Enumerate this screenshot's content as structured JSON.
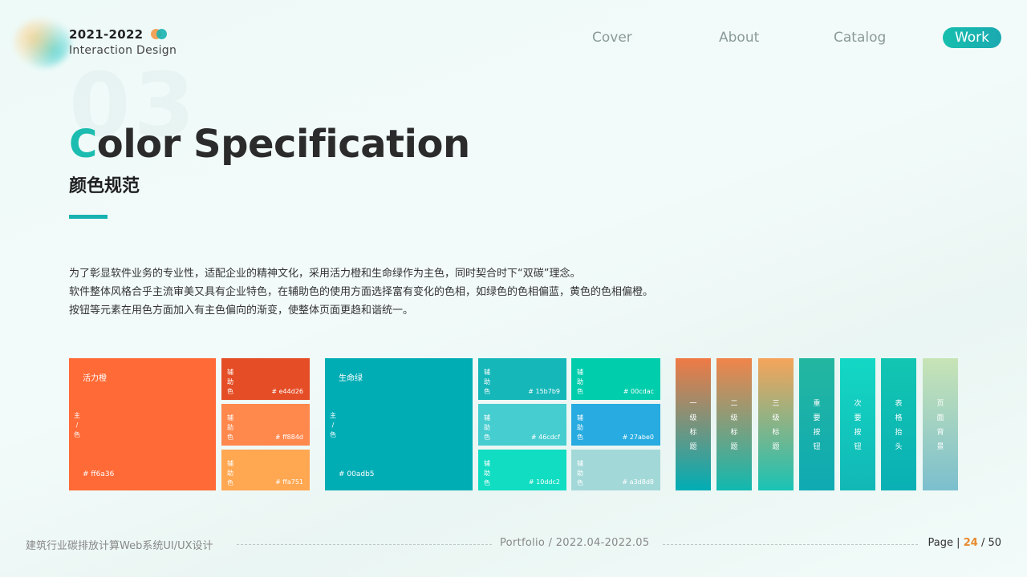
{
  "brand": {
    "year": "2021-2022",
    "subtitle": "Interaction Design"
  },
  "nav": {
    "items": [
      "Cover",
      "About",
      "Catalog",
      "Work"
    ],
    "active": "Work"
  },
  "section": {
    "number": "03",
    "title_first": "C",
    "title_rest": "olor Specification",
    "subtitle": "颜色规范"
  },
  "description": [
    "为了彰显软件业务的专业性，适配企业的精神文化，采用活力橙和生命绿作为主色，同时契合时下“双碳”理念。",
    "软件整体风格合乎主流审美又具有企业特色，在辅助色的使用方面选择富有变化的色相，如绿色的色相偏蓝，黄色的色相偏橙。",
    "按钮等元素在用色方面加入有主色偏向的渐变，使整体页面更趋和谐统一。"
  ],
  "palette": {
    "orange_main": {
      "name": "活力橙",
      "tag": "主/色",
      "hex": "# ff6a36",
      "color": "#ff6a36"
    },
    "orange_aux": [
      {
        "tag": "辅助色",
        "hex": "# e44d26",
        "color": "#e44d26"
      },
      {
        "tag": "辅助色",
        "hex": "# ff884d",
        "color": "#ff884d"
      },
      {
        "tag": "辅助色",
        "hex": "# ffa751",
        "color": "#ffa751"
      }
    ],
    "green_main": {
      "name": "生命绿",
      "tag": "主/色",
      "hex": "# 00adb5",
      "color": "#00adb5"
    },
    "green_aux": [
      {
        "tag": "辅助色",
        "hex": "# 15b7b9",
        "color": "#15b7b9"
      },
      {
        "tag": "辅助色",
        "hex": "# 00cdac",
        "color": "#00cdac"
      },
      {
        "tag": "辅助色",
        "hex": "# 46cdcf",
        "color": "#46cdcf"
      },
      {
        "tag": "辅助色",
        "hex": "# 27abe0",
        "color": "#27abe0"
      },
      {
        "tag": "辅助色",
        "hex": "# 10ddc2",
        "color": "#10ddc2"
      },
      {
        "tag": "辅助色",
        "hex": "# a3d8d8",
        "color": "#a3d8d8"
      }
    ]
  },
  "gradients": [
    {
      "label": "一级标题",
      "from": "#f07a45",
      "to": "#00adb5"
    },
    {
      "label": "二级标题",
      "from": "#f1844a",
      "to": "#10b9b0"
    },
    {
      "label": "三级标题",
      "from": "#f6a45a",
      "to": "#19c3b5"
    },
    {
      "label": "重要按钮",
      "from": "#23b6a0",
      "to": "#0faab3"
    },
    {
      "label": "次要按钮",
      "from": "#13d8c4",
      "to": "#12b7b6"
    },
    {
      "label": "表格抬头",
      "from": "#12c6b2",
      "to": "#0ab0b4"
    },
    {
      "label": "页面背景",
      "from": "#c8e4b6",
      "to": "#7bbfce"
    }
  ],
  "footer": {
    "left": "建筑行业碳排放计算Web系统UI/UX设计",
    "middle": "Portfolio / 2022.04-2022.05",
    "page_label": "Page",
    "sep": "|",
    "current": "24",
    "total": "/ 50"
  }
}
